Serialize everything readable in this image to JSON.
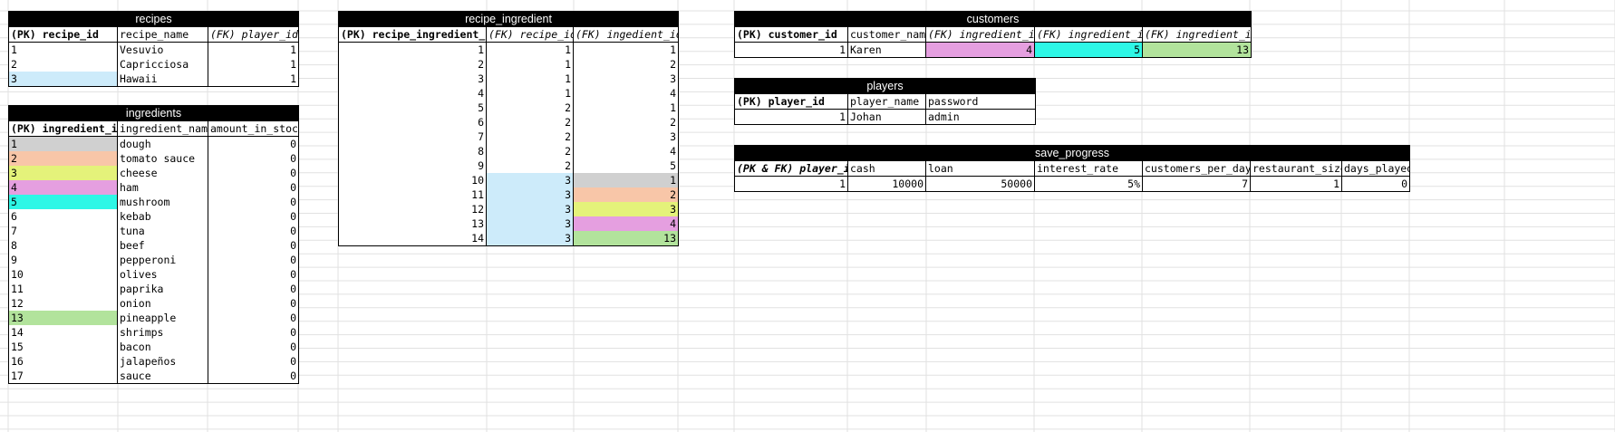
{
  "colors": {
    "grey": "#d0d0d0",
    "salmon": "#f8c6a8",
    "yellow": "#e4f27a",
    "pink": "#e59fe0",
    "cyan": "#2ef7e6",
    "green": "#b2e39c",
    "blue": "#cdebfa",
    "gridline": "#e1e1e1",
    "header": "#000000"
  },
  "recipes": {
    "title": "recipes",
    "columns": [
      "(PK) recipe_id",
      "recipe_name",
      "(FK) player_id"
    ],
    "rows": [
      {
        "cells": [
          "1",
          "Vesuvio",
          "1"
        ],
        "hl": [
          "",
          "",
          ""
        ]
      },
      {
        "cells": [
          "2",
          "Capricciosa",
          "1"
        ],
        "hl": [
          "",
          "",
          ""
        ]
      },
      {
        "cells": [
          "3",
          "Hawaii",
          "1"
        ],
        "hl": [
          "blue",
          "",
          ""
        ]
      }
    ]
  },
  "ingredients": {
    "title": "ingredients",
    "columns": [
      "(PK) ingredient_id",
      "ingredient_name",
      "amount_in_stock"
    ],
    "rows": [
      {
        "cells": [
          "1",
          "dough",
          "0"
        ],
        "hl": [
          "grey",
          "",
          ""
        ]
      },
      {
        "cells": [
          "2",
          "tomato sauce",
          "0"
        ],
        "hl": [
          "salmon",
          "",
          ""
        ]
      },
      {
        "cells": [
          "3",
          "cheese",
          "0"
        ],
        "hl": [
          "yellow",
          "",
          ""
        ]
      },
      {
        "cells": [
          "4",
          "ham",
          "0"
        ],
        "hl": [
          "pink",
          "",
          ""
        ]
      },
      {
        "cells": [
          "5",
          "mushroom",
          "0"
        ],
        "hl": [
          "cyan",
          "",
          ""
        ]
      },
      {
        "cells": [
          "6",
          "kebab",
          "0"
        ],
        "hl": [
          "",
          "",
          ""
        ]
      },
      {
        "cells": [
          "7",
          "tuna",
          "0"
        ],
        "hl": [
          "",
          "",
          ""
        ]
      },
      {
        "cells": [
          "8",
          "beef",
          "0"
        ],
        "hl": [
          "",
          "",
          ""
        ]
      },
      {
        "cells": [
          "9",
          "pepperoni",
          "0"
        ],
        "hl": [
          "",
          "",
          ""
        ]
      },
      {
        "cells": [
          "10",
          "olives",
          "0"
        ],
        "hl": [
          "",
          "",
          ""
        ]
      },
      {
        "cells": [
          "11",
          "paprika",
          "0"
        ],
        "hl": [
          "",
          "",
          ""
        ]
      },
      {
        "cells": [
          "12",
          "onion",
          "0"
        ],
        "hl": [
          "",
          "",
          ""
        ]
      },
      {
        "cells": [
          "13",
          "pineapple",
          "0"
        ],
        "hl": [
          "green",
          "",
          ""
        ]
      },
      {
        "cells": [
          "14",
          "shrimps",
          "0"
        ],
        "hl": [
          "",
          "",
          ""
        ]
      },
      {
        "cells": [
          "15",
          "bacon",
          "0"
        ],
        "hl": [
          "",
          "",
          ""
        ]
      },
      {
        "cells": [
          "16",
          "jalapeños",
          "0"
        ],
        "hl": [
          "",
          "",
          ""
        ]
      },
      {
        "cells": [
          "17",
          "sauce",
          "0"
        ],
        "hl": [
          "",
          "",
          ""
        ]
      }
    ]
  },
  "recipe_ingredient": {
    "title": "recipe_ingredient",
    "columns": [
      "(PK) recipe_ingredient_id",
      "(FK) recipe_id",
      "(FK) ingedient_id"
    ],
    "rows": [
      {
        "cells": [
          "1",
          "1",
          "1"
        ],
        "hl": [
          "",
          "",
          ""
        ]
      },
      {
        "cells": [
          "2",
          "1",
          "2"
        ],
        "hl": [
          "",
          "",
          ""
        ]
      },
      {
        "cells": [
          "3",
          "1",
          "3"
        ],
        "hl": [
          "",
          "",
          ""
        ]
      },
      {
        "cells": [
          "4",
          "1",
          "4"
        ],
        "hl": [
          "",
          "",
          ""
        ]
      },
      {
        "cells": [
          "5",
          "2",
          "1"
        ],
        "hl": [
          "",
          "",
          ""
        ]
      },
      {
        "cells": [
          "6",
          "2",
          "2"
        ],
        "hl": [
          "",
          "",
          ""
        ]
      },
      {
        "cells": [
          "7",
          "2",
          "3"
        ],
        "hl": [
          "",
          "",
          ""
        ]
      },
      {
        "cells": [
          "8",
          "2",
          "4"
        ],
        "hl": [
          "",
          "",
          ""
        ]
      },
      {
        "cells": [
          "9",
          "2",
          "5"
        ],
        "hl": [
          "",
          "",
          ""
        ]
      },
      {
        "cells": [
          "10",
          "3",
          "1"
        ],
        "hl": [
          "",
          "blue",
          "grey"
        ]
      },
      {
        "cells": [
          "11",
          "3",
          "2"
        ],
        "hl": [
          "",
          "blue",
          "salmon"
        ]
      },
      {
        "cells": [
          "12",
          "3",
          "3"
        ],
        "hl": [
          "",
          "blue",
          "yellow"
        ]
      },
      {
        "cells": [
          "13",
          "3",
          "4"
        ],
        "hl": [
          "",
          "blue",
          "pink"
        ]
      },
      {
        "cells": [
          "14",
          "3",
          "13"
        ],
        "hl": [
          "",
          "blue",
          "green"
        ]
      }
    ]
  },
  "customers": {
    "title": "customers",
    "columns": [
      "(PK) customer_id",
      "customer_name",
      "(FK) ingredient_id",
      "(FK) ingredient_id",
      "(FK) ingredient_id"
    ],
    "rows": [
      {
        "cells": [
          "1",
          "Karen",
          "4",
          "5",
          "13"
        ],
        "hl": [
          "",
          "",
          "pink",
          "cyan",
          "green"
        ]
      }
    ]
  },
  "players": {
    "title": "players",
    "columns": [
      "(PK) player_id",
      "player_name",
      "password"
    ],
    "rows": [
      {
        "cells": [
          "1",
          "Johan",
          "admin"
        ],
        "hl": [
          "",
          "",
          ""
        ]
      }
    ]
  },
  "save_progress": {
    "title": "save_progress",
    "columns": [
      "(PK & FK) player_id",
      "cash",
      "loan",
      "interest_rate",
      "customers_per_day",
      "restaurant_size",
      "days_played"
    ],
    "rows": [
      {
        "cells": [
          "1",
          "10000",
          "50000",
          "5%",
          "7",
          "1",
          "0"
        ],
        "hl": [
          "",
          "",
          "",
          "",
          "",
          "",
          ""
        ]
      }
    ]
  }
}
